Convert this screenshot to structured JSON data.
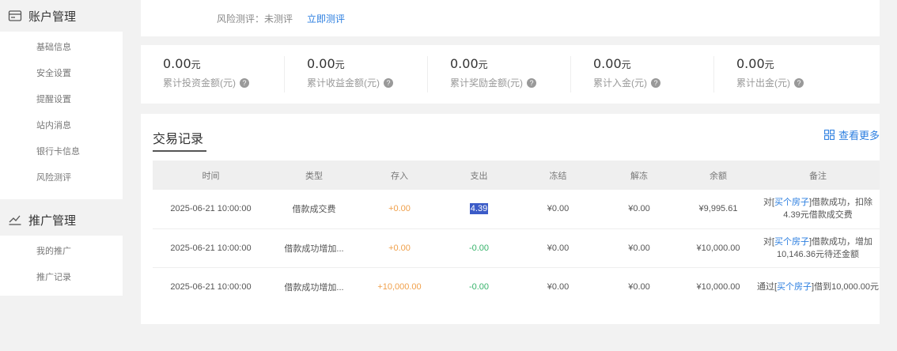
{
  "sidebar": {
    "groups": [
      {
        "title": "账户管理",
        "icon": "account-card-icon",
        "items": [
          "基础信息",
          "安全设置",
          "提醒设置",
          "站内消息",
          "银行卡信息",
          "风险测评"
        ]
      },
      {
        "title": "推广管理",
        "icon": "trend-chart-icon",
        "items": [
          "我的推广",
          "推广记录"
        ]
      }
    ]
  },
  "risk": {
    "label": "风险测评：未测评",
    "action": "立即测评"
  },
  "stats": [
    {
      "value": "0.00",
      "unit": "元",
      "label": "累计投资金额(元)"
    },
    {
      "value": "0.00",
      "unit": "元",
      "label": "累计收益金额(元)"
    },
    {
      "value": "0.00",
      "unit": "元",
      "label": "累计奖励金额(元)"
    },
    {
      "value": "0.00",
      "unit": "元",
      "label": "累计入金(元)"
    },
    {
      "value": "0.00",
      "unit": "元",
      "label": "累计出金(元)"
    }
  ],
  "transactions": {
    "title": "交易记录",
    "more_label": "查看更多",
    "columns": [
      "时间",
      "类型",
      "存入",
      "支出",
      "冻结",
      "解冻",
      "余额",
      "备注"
    ],
    "rows": [
      {
        "time": "2025-06-21 10:00:00",
        "type": "借款成交费",
        "in": "+0.00",
        "out": "4.39",
        "frozen": "¥0.00",
        "unfrozen": "¥0.00",
        "balance": "¥9,995.61",
        "note_prefix": "对[",
        "note_link": "买个房子",
        "note_suffix": "]借款成功，扣除4.39元借款成交费"
      },
      {
        "time": "2025-06-21 10:00:00",
        "type": "借款成功增加...",
        "in": "+0.00",
        "out": "-0.00",
        "frozen": "¥0.00",
        "unfrozen": "¥0.00",
        "balance": "¥10,000.00",
        "note_prefix": "对[",
        "note_link": "买个房子",
        "note_suffix": "]借款成功，增加10,146.36元待还金额"
      },
      {
        "time": "2025-06-21 10:00:00",
        "type": "借款成功增加...",
        "in": "+10,000.00",
        "out": "-0.00",
        "frozen": "¥0.00",
        "unfrozen": "¥0.00",
        "balance": "¥10,000.00",
        "note_prefix": "通过[",
        "note_link": "买个房子",
        "note_suffix": "]借到10,000.00元"
      }
    ]
  }
}
